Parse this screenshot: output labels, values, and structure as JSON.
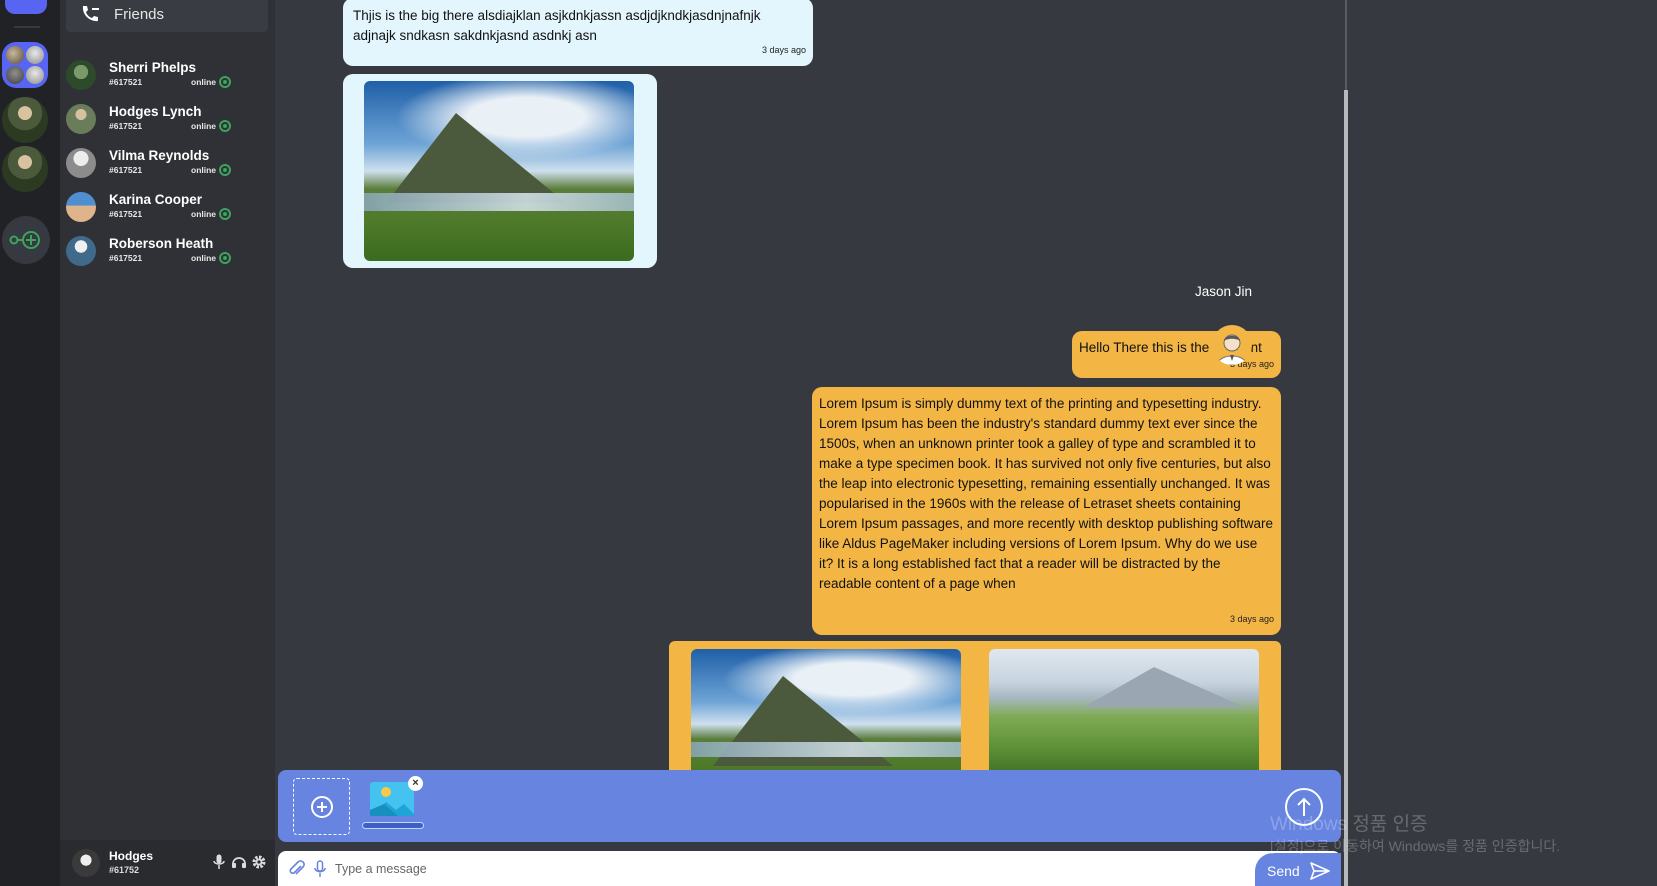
{
  "nav": {
    "friends_label": "Friends"
  },
  "direct_messages": [
    {
      "name": "Sherri Phelps",
      "tag": "#617521",
      "status": "online"
    },
    {
      "name": "Hodges Lynch",
      "tag": "#617521",
      "status": "online"
    },
    {
      "name": "Vilma Reynolds",
      "tag": "#617521",
      "status": "online"
    },
    {
      "name": "Karina Cooper",
      "tag": "#617521",
      "status": "online"
    },
    {
      "name": "Roberson Heath",
      "tag": "#617521",
      "status": "online"
    }
  ],
  "current_user": {
    "name": "Hodges",
    "tag": "#61752"
  },
  "messages": {
    "received_text": "Thjis is the big there alsdiajklan asjkdnkjassn asdjdjkndkjasdnjnafnjk adjnajk sndkasn sakdnkjasnd asdnkj asn",
    "received_time": "3 days ago",
    "sender_name": "Jason Jin",
    "sent_short": "Hello There this is the moment",
    "sent_short_time": "3 days ago",
    "sent_long": "Lorem Ipsum is simply dummy text of the printing and typesetting industry. Lorem Ipsum has been the industry's standard dummy text ever since the 1500s, when an unknown printer took a galley of type and scrambled it to make a type specimen book. It has survived not only five centuries, but also the leap into electronic typesetting, remaining essentially unchanged. It was popularised in the 1960s with the release of Letraset sheets containing Lorem Ipsum passages, and more recently with desktop publishing software like Aldus PageMaker including versions of Lorem Ipsum. Why do we use it? It is a long established fact that a reader will be distracted by the readable content of a page when",
    "sent_long_time": "3 days ago"
  },
  "composer": {
    "placeholder": "Type a message",
    "send_label": "Send",
    "remove_label": "×"
  },
  "watermark": {
    "title": "Windows 정품 인증",
    "subtitle": "[설정]으로 이동하여 Windows를 정품 인증합니다."
  },
  "colors": {
    "accent": "#5865f2",
    "upload_bar": "#6684e0",
    "sent_bubble": "#f3b645",
    "received_bubble": "#e3f6fd",
    "online": "#3ba55d"
  }
}
